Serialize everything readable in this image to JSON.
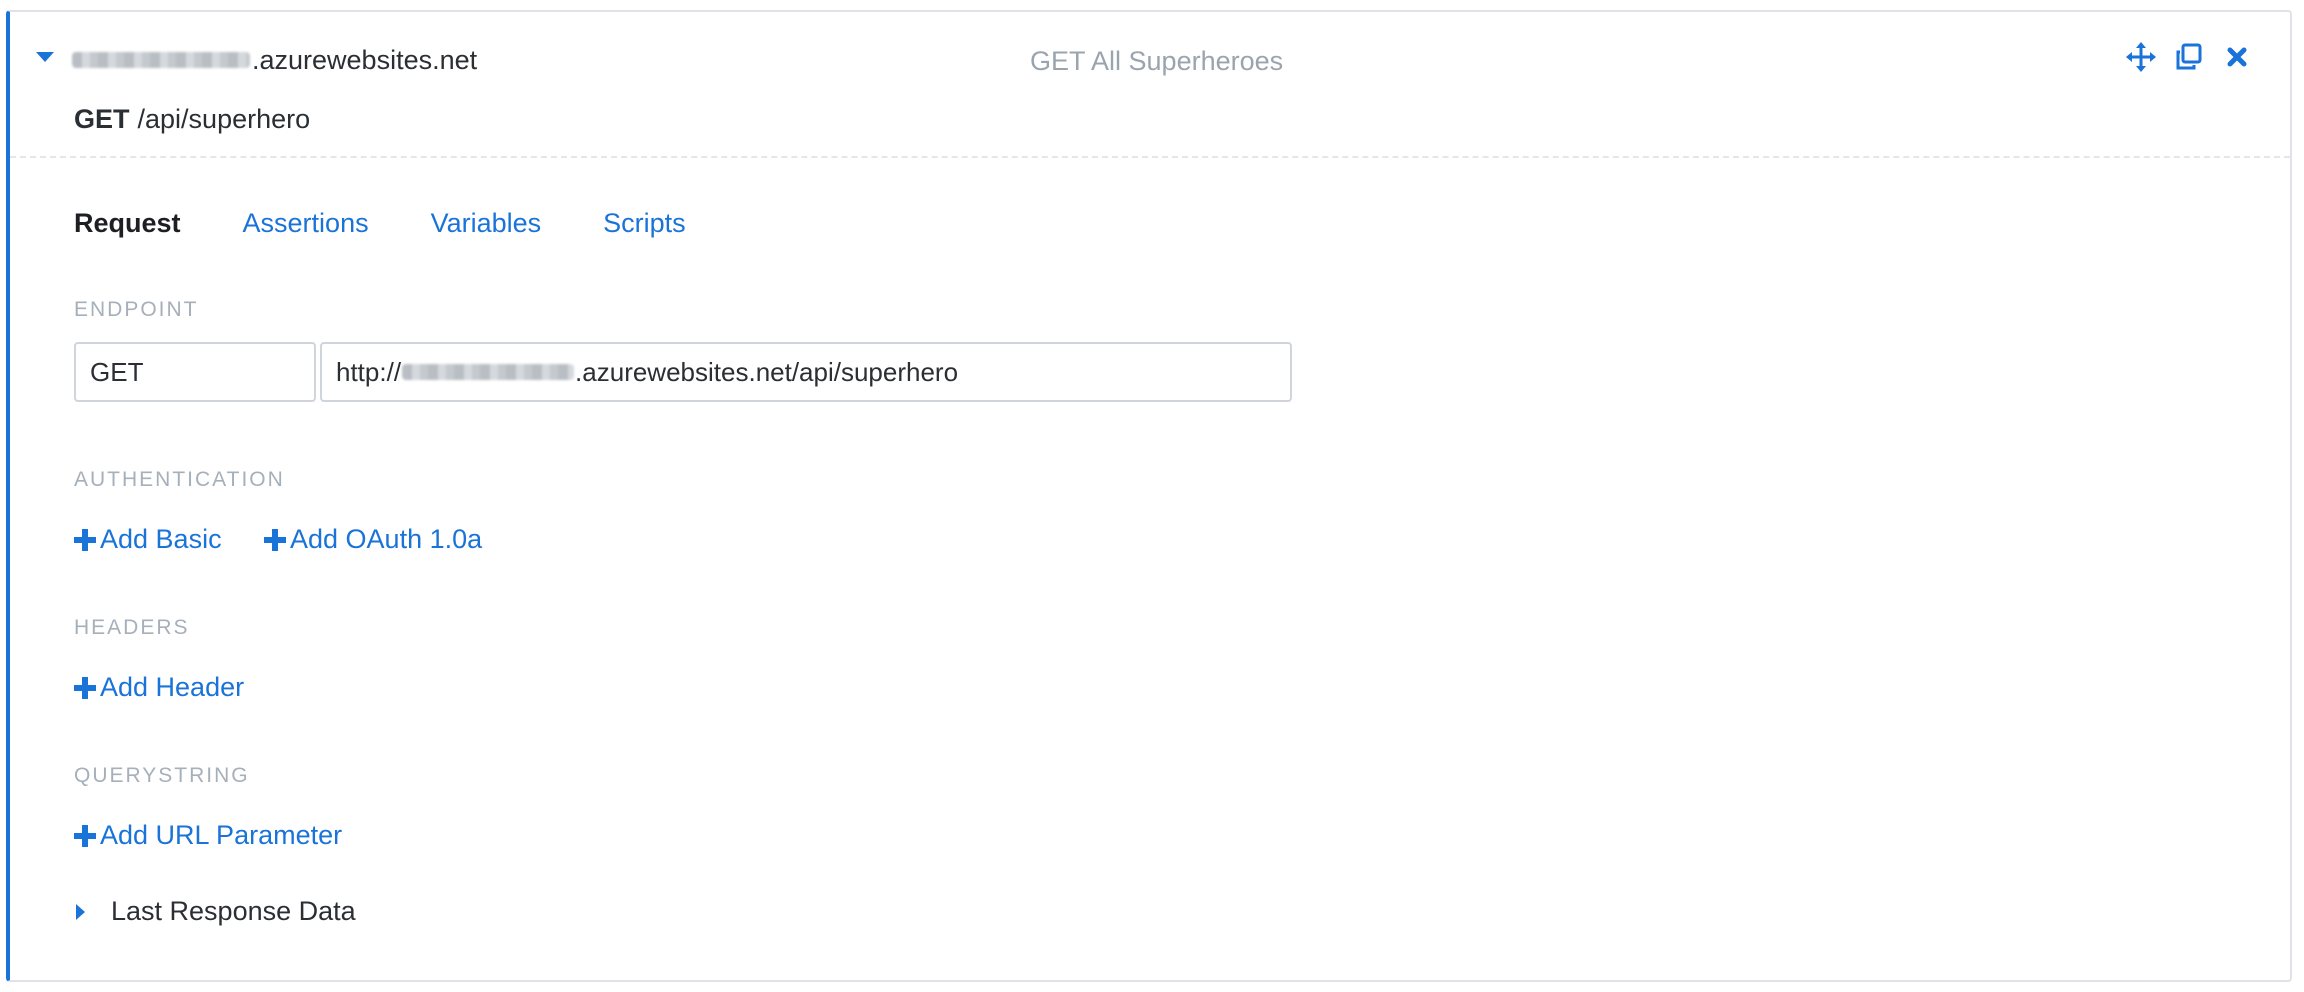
{
  "header": {
    "host_suffix": ".azurewebsites.net",
    "request_name": "GET All Superheroes",
    "method": "GET",
    "path": "/api/superhero",
    "icons": [
      "move-icon",
      "clone-icon",
      "close-icon"
    ]
  },
  "tabs": [
    {
      "label": "Request",
      "active": true
    },
    {
      "label": "Assertions",
      "active": false
    },
    {
      "label": "Variables",
      "active": false
    },
    {
      "label": "Scripts",
      "active": false
    }
  ],
  "endpoint": {
    "section_label": "ENDPOINT",
    "method_value": "GET",
    "url_prefix": "http://",
    "url_suffix": ".azurewebsites.net/api/superhero"
  },
  "authentication": {
    "section_label": "AUTHENTICATION",
    "add_basic": "Add Basic",
    "add_oauth": "Add OAuth 1.0a"
  },
  "headers": {
    "section_label": "HEADERS",
    "add_header": "Add Header"
  },
  "querystring": {
    "section_label": "QUERYSTRING",
    "add_param": "Add URL Parameter"
  },
  "last_response": {
    "label": "Last Response Data"
  },
  "colors": {
    "accent": "#1a73d9",
    "muted": "#a6b0ba",
    "text": "#2b2f33",
    "border": "#cfd5db"
  }
}
